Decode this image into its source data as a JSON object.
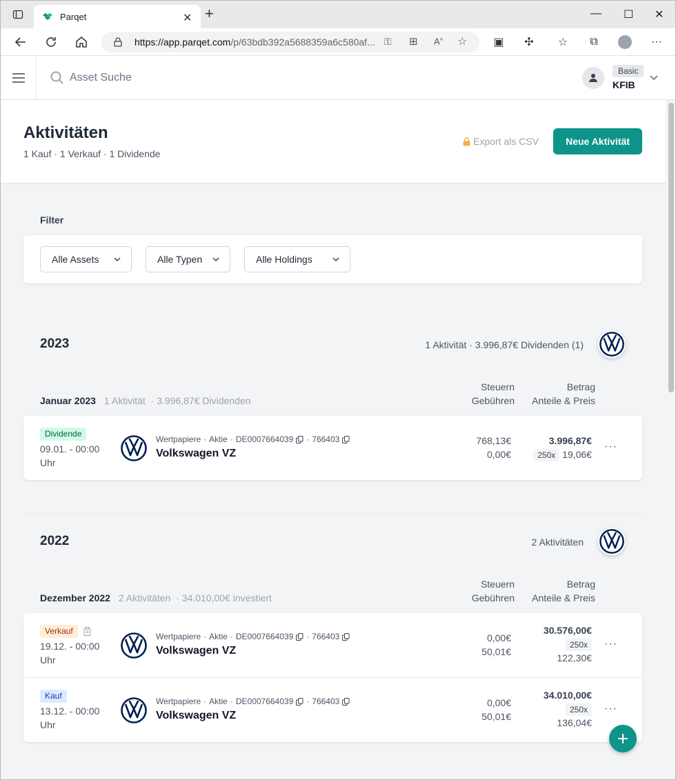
{
  "browser": {
    "tab_title": "Parqet",
    "url_host": "https://app.parqet.com",
    "url_path": "/p/63bdb392a5688359a6c580af..."
  },
  "header": {
    "search_placeholder": "Asset Suche",
    "plan": "Basic",
    "user": "KFIB"
  },
  "page": {
    "title": "Aktivitäten",
    "subtitle": "1 Kauf · 1 Verkauf · 1 Dividende",
    "export_label": "Export als CSV",
    "new_button": "Neue Aktivität"
  },
  "filter": {
    "label": "Filter",
    "selects": [
      "Alle Assets",
      "Alle Typen",
      "Alle Holdings"
    ]
  },
  "columns": {
    "tax": "Steuern",
    "fees": "Gebühren",
    "amount": "Betrag",
    "shares_price": "Anteile & Preis"
  },
  "years": [
    {
      "year": "2023",
      "summary": "1 Aktivität · 3.996,87€ Dividenden (1)",
      "month": "Januar 2023",
      "month_count": "1 Aktivität",
      "month_info": "· 3.996,87€ Dividenden",
      "rows": [
        {
          "type": "Dividende",
          "date": "09.01. - 00:00 Uhr",
          "meta": [
            "Wertpapiere",
            "·",
            "Aktie",
            "·",
            "DE0007664039",
            "·",
            "766403"
          ],
          "name": "Volkswagen VZ",
          "tax": "768,13€",
          "fees": "0,00€",
          "amount": "3.996,87€",
          "shares": "250x",
          "price": "19,06€"
        }
      ]
    },
    {
      "year": "2022",
      "summary": "2 Aktivitäten",
      "month": "Dezember 2022",
      "month_count": "2 Aktivitäten",
      "month_info": "· 34.010,00€ investiert",
      "rows": [
        {
          "type": "Verkauf",
          "date": "19.12. - 00:00 Uhr",
          "meta": [
            "Wertpapiere",
            "·",
            "Aktie",
            "·",
            "DE0007664039",
            "·",
            "766403"
          ],
          "name": "Volkswagen VZ",
          "tax": "0,00€",
          "fees": "50,01€",
          "amount": "30.576,00€",
          "shares": "250x",
          "price": "122,30€"
        },
        {
          "type": "Kauf",
          "date": "13.12. - 00:00 Uhr",
          "meta": [
            "Wertpapiere",
            "·",
            "Aktie",
            "·",
            "DE0007664039",
            "·",
            "766403"
          ],
          "name": "Volkswagen VZ",
          "tax": "0,00€",
          "fees": "50,01€",
          "amount": "34.010,00€",
          "shares": "250x",
          "price": "136,04€"
        }
      ]
    }
  ],
  "colors": {
    "accent": "#0e9488",
    "vw_blue": "#001e50"
  }
}
